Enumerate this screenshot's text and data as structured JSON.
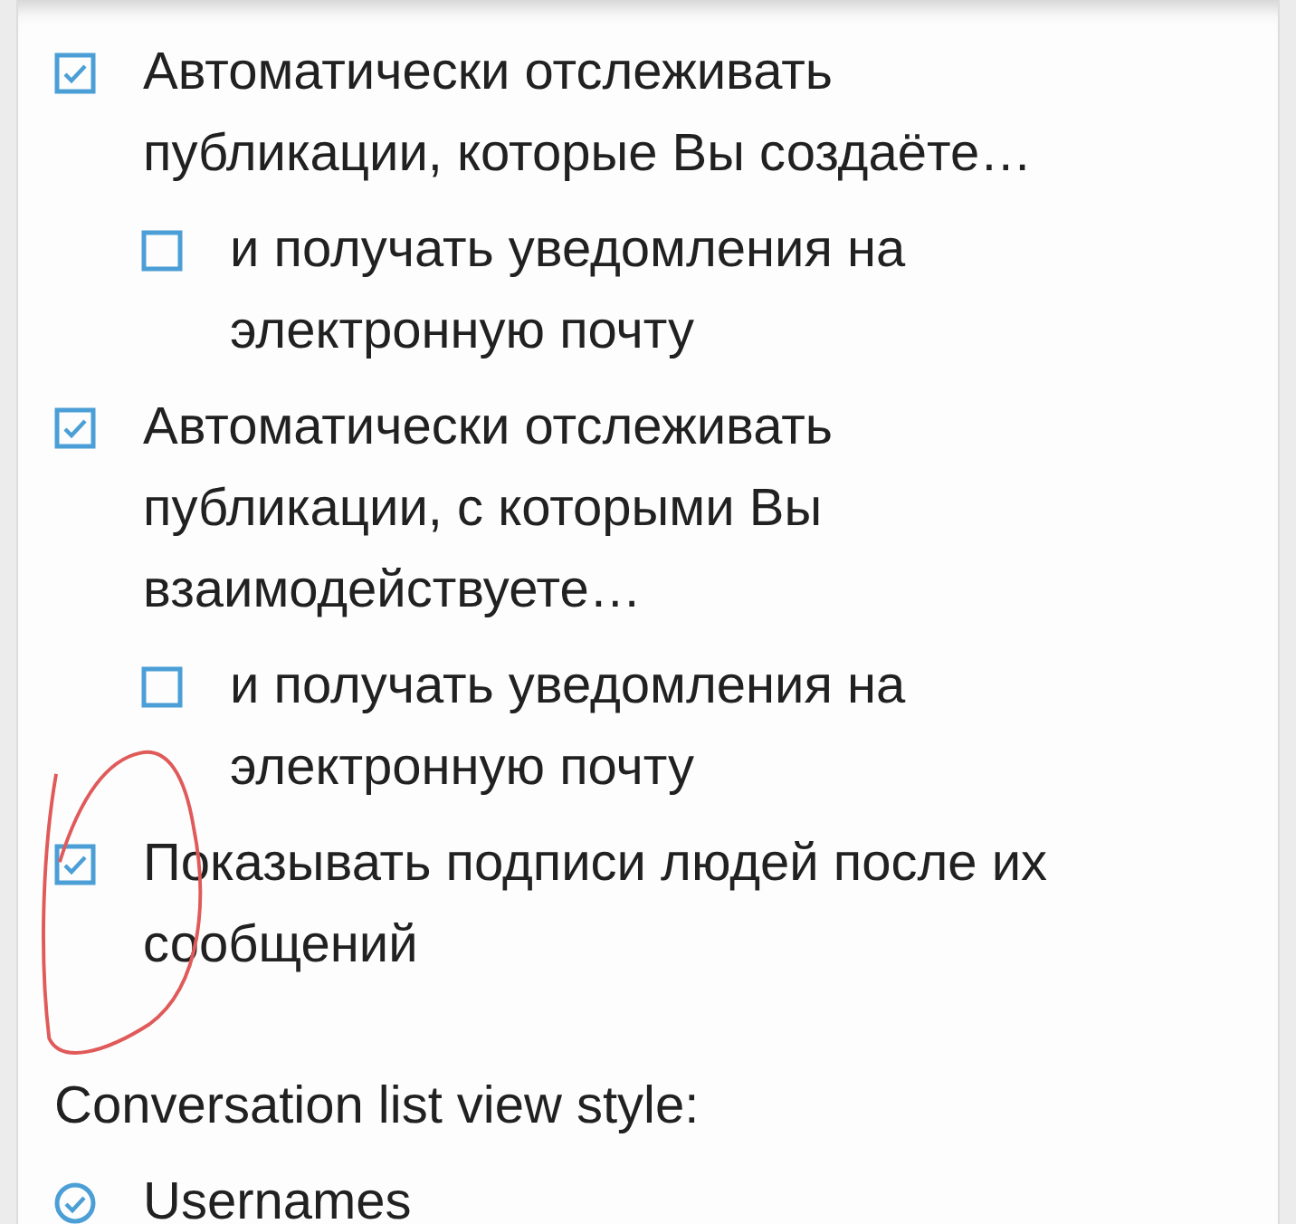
{
  "options": [
    {
      "label": "Автоматически отслеживать публикации, которые Вы создаёте…",
      "checked": true,
      "children": [
        {
          "label": "и получать уведомления на электронную почту",
          "checked": false
        }
      ]
    },
    {
      "label": "Автоматически отслеживать публикации, с которыми Вы взаимодействуете…",
      "checked": true,
      "children": [
        {
          "label": "и получать уведомления на электронную почту",
          "checked": false
        }
      ]
    },
    {
      "label": "Показывать подписи людей после их сообщений",
      "checked": true
    }
  ],
  "view_style": {
    "label": "Conversation list view style:",
    "choices": [
      {
        "label": "Usernames",
        "selected": true
      }
    ]
  }
}
